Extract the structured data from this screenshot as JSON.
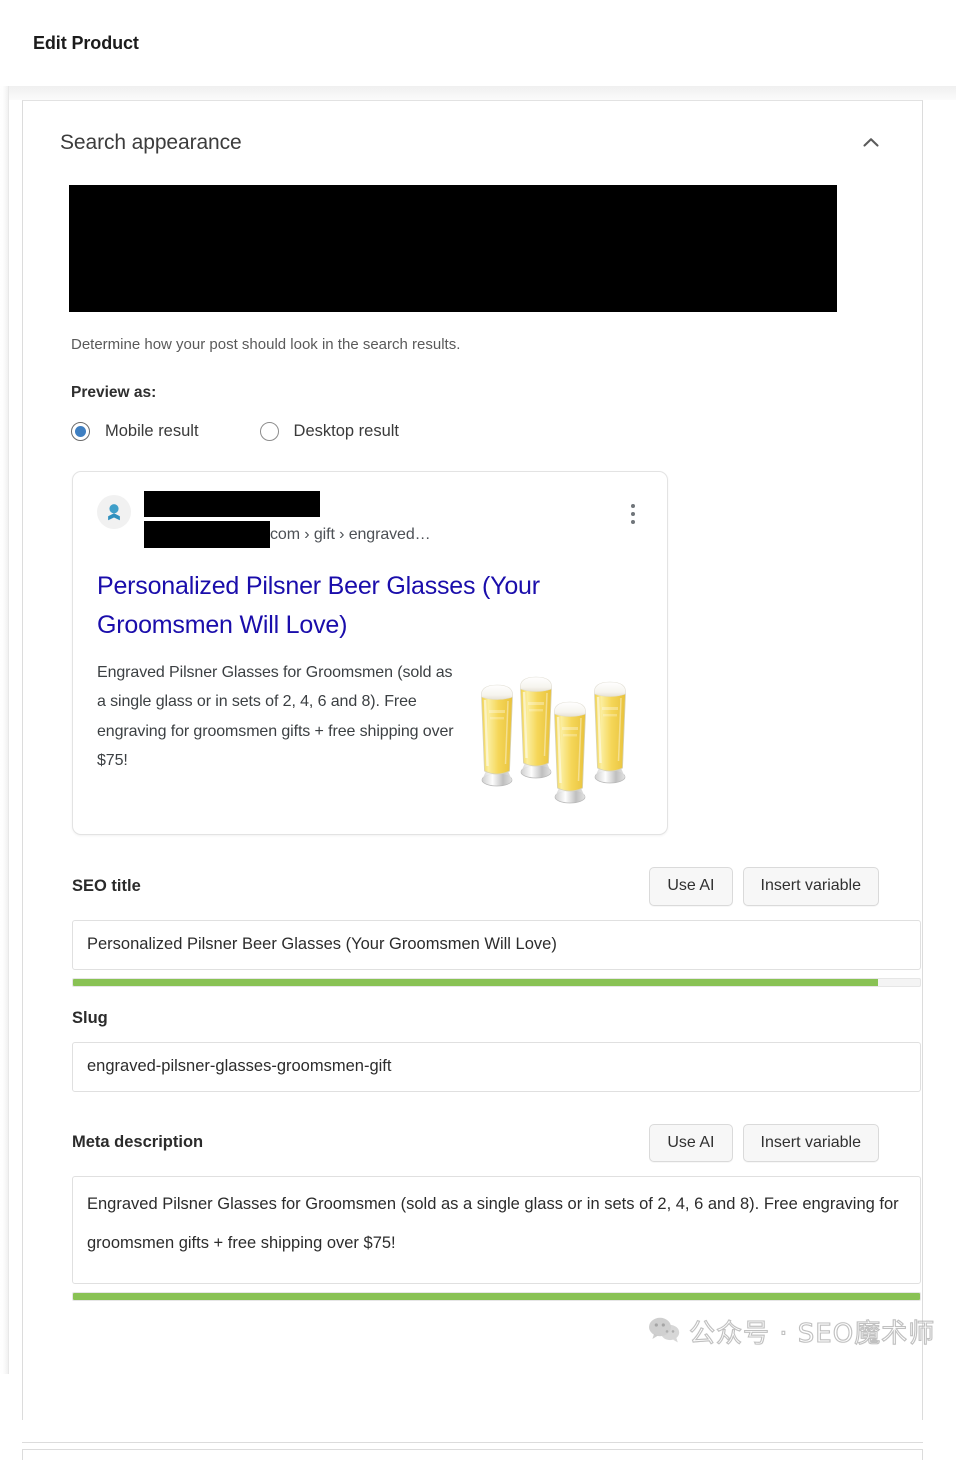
{
  "topbar": {
    "title": "Edit Product"
  },
  "panel": {
    "heading": "Search appearance",
    "collapse_icon": "chevron-up-icon",
    "help_text": "Determine how your post should look in the search results.",
    "preview_as_label": "Preview as:",
    "preview_options": [
      {
        "label": "Mobile result",
        "selected": true
      },
      {
        "label": "Desktop result",
        "selected": false
      }
    ]
  },
  "serp_preview": {
    "favicon_icon": "site-favicon-icon",
    "site_name_redacted": true,
    "url_redacted": true,
    "url_text": "com › gift › engraved…",
    "menu_icon": "kebab-menu-icon",
    "title": "Personalized Pilsner Beer Glasses (Your Groomsmen Will Love)",
    "description": "Engraved Pilsner Glasses for Groomsmen (sold as a single glass or in sets of 2, 4, 6 and 8). Free engraving for groomsmen gifts + free shipping over $75!",
    "thumbnail_icon": "pilsner-beer-glasses-image"
  },
  "seo_title": {
    "label": "SEO title",
    "use_ai_label": "Use AI",
    "insert_variable_label": "Insert variable",
    "value": "Personalized Pilsner Beer Glasses (Your Groomsmen Will Love)",
    "meter_percent": 95
  },
  "slug": {
    "label": "Slug",
    "value": "engraved-pilsner-glasses-groomsmen-gift"
  },
  "meta_description": {
    "label": "Meta description",
    "use_ai_label": "Use AI",
    "insert_variable_label": "Insert variable",
    "value": "Engraved Pilsner Glasses for Groomsmen (sold as a single glass or in sets of 2, 4, 6 and 8). Free engraving for groomsmen gifts + free shipping over $75!",
    "meter_percent": 100
  },
  "watermark": {
    "text": "公众号 · SEO魔术师",
    "icon": "wechat-bubbles-icon"
  },
  "colors": {
    "meter_green": "#89c254",
    "serp_link_blue": "#1a0dab",
    "radio_blue": "#3f7fc1"
  }
}
